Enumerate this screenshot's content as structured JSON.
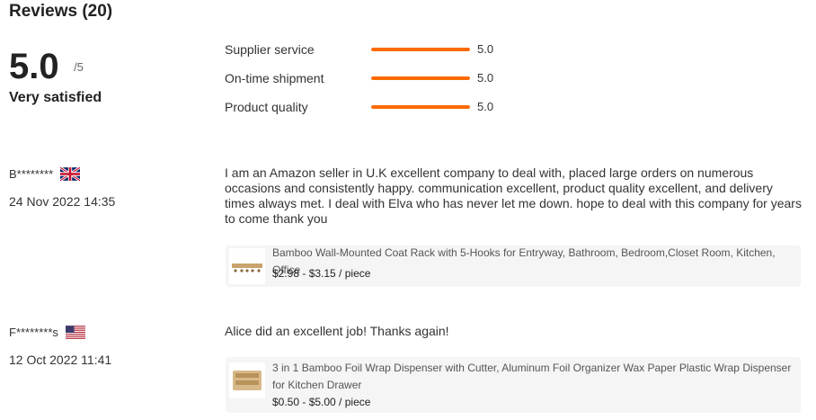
{
  "reviews_header": {
    "title": "Reviews (20)"
  },
  "summary": {
    "score": "5.0",
    "score_max": "/5",
    "label": "Very satisfied"
  },
  "metrics": [
    {
      "label": "Supplier service",
      "value": "5.0",
      "fill": 1.0
    },
    {
      "label": "On-time shipment",
      "value": "5.0",
      "fill": 1.0
    },
    {
      "label": "Product quality",
      "value": "5.0",
      "fill": 1.0
    }
  ],
  "reviews": [
    {
      "reviewer": "B******** ",
      "flag_icon": "uk-flag-icon",
      "date": "24 Nov 2022 14:35",
      "text": "I am an Amazon seller in U.K excellent company to deal with, placed large orders on numerous occasions and consistently happy. communication excellent, product quality excellent, and delivery times always met. I deal with Elva who has never let me down. hope to deal with this company for years to come thank you",
      "product": {
        "title": "Bamboo Wall-Mounted Coat Rack with 5-Hooks for Entryway, Bathroom, Bedroom,Closet Room, Kitchen, Office",
        "price": "$2.98 - $3.15 / piece",
        "thumb_icon": "coat-rack-thumbnail"
      }
    },
    {
      "reviewer": "F********s",
      "flag_icon": "us-flag-icon",
      "date": "12 Oct 2022 11:41",
      "text": "Alice did an excellent job! Thanks again!",
      "product": {
        "title": "3 in 1 Bamboo Foil Wrap Dispenser with Cutter, Aluminum Foil Organizer Wax Paper Plastic Wrap Dispenser for Kitchen Drawer",
        "price": "$0.50 - $5.00 / piece",
        "thumb_icon": "foil-dispenser-thumbnail"
      }
    }
  ],
  "colors": {
    "accent": "#ff6a00",
    "card_bg": "#f5f5f5"
  }
}
